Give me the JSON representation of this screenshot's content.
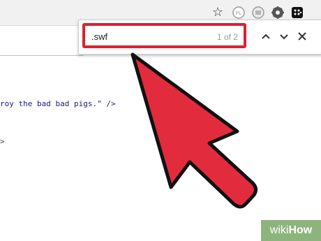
{
  "toolbar": {
    "icons": [
      "star-icon",
      "extension-pl-icon",
      "extension-plain-icon",
      "extension-gear-icon",
      "extension-blackberry-icon"
    ],
    "ext_pl_label": "PL"
  },
  "page": {
    "code_line_1": "roy the bad bad pigs.\" />",
    "code_line_2": ">"
  },
  "find_bar": {
    "query": ".swf",
    "count": "1 of 2",
    "highlight_color": "#d9222e"
  },
  "overlay": {
    "arrow_color": "#e32b3e",
    "arrow_outline_color": "#111111"
  },
  "watermark": {
    "wiki": "wiki",
    "how": "How"
  }
}
